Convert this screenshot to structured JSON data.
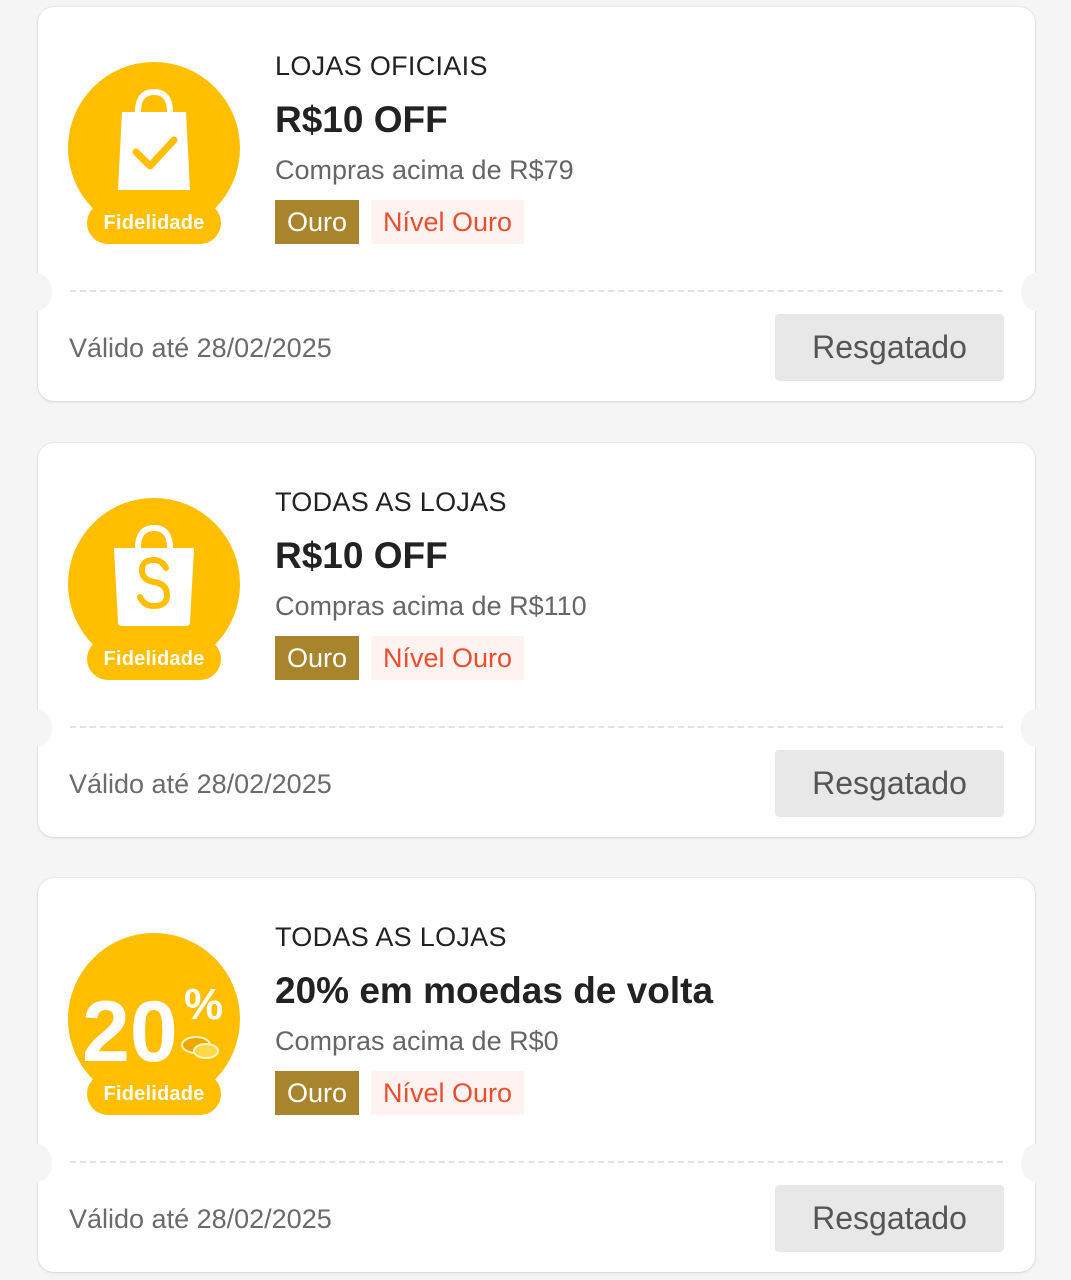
{
  "coupons": [
    {
      "badge_icon": "shopping-bag-check-icon",
      "badge_label": "Fidelidade",
      "category": "LOJAS OFICIAIS",
      "title": "R$10 OFF",
      "condition": "Compras acima de R$79",
      "tag_tier": "Ouro",
      "tag_level": "Nível Ouro",
      "validity": "Válido até 28/02/2025",
      "button": "Resgatado"
    },
    {
      "badge_icon": "shopee-bag-icon",
      "badge_label": "Fidelidade",
      "category": "TODAS AS LOJAS",
      "title": "R$10 OFF",
      "condition": "Compras acima de R$110",
      "tag_tier": "Ouro",
      "tag_level": "Nível Ouro",
      "validity": "Válido até 28/02/2025",
      "button": "Resgatado"
    },
    {
      "badge_icon": "coins-cashback-icon",
      "badge_number": "20",
      "badge_percent": "%",
      "badge_label": "Fidelidade",
      "category": "TODAS AS LOJAS",
      "title": "20% em moedas de volta",
      "condition": "Compras acima de R$0",
      "tag_tier": "Ouro",
      "tag_level": "Nível Ouro",
      "validity": "Válido até 28/02/2025",
      "button": "Resgatado"
    }
  ],
  "colors": {
    "badge_yellow": "#ffbf00",
    "tier_gold": "#a8842c",
    "level_red": "#e94e2e",
    "button_bg": "#e8e8e8"
  }
}
